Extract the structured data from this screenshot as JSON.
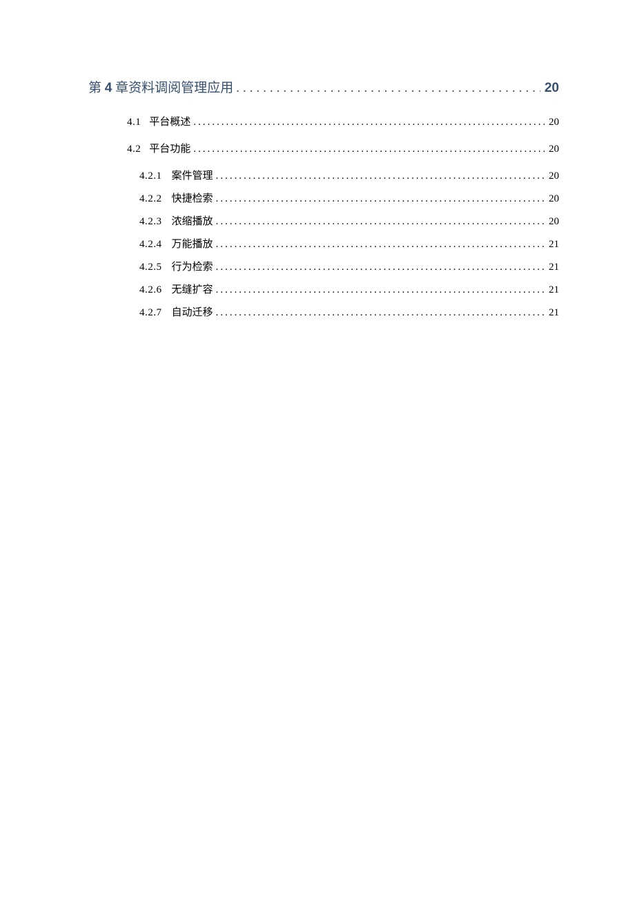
{
  "chapter": {
    "prefix": "第 ",
    "num": "4",
    "suffix": " 章",
    "title": "资料调阅管理应用",
    "page": "20"
  },
  "sections": [
    {
      "num": "4.1",
      "title": "平台概述",
      "page": "20"
    },
    {
      "num": "4.2",
      "title": "平台功能",
      "page": "20"
    }
  ],
  "subsections": [
    {
      "num": "4.2.1",
      "title": "案件管理",
      "page": "20"
    },
    {
      "num": "4.2.2",
      "title": "快捷检索",
      "page": "20"
    },
    {
      "num": "4.2.3",
      "title": "浓缩播放",
      "page": "20"
    },
    {
      "num": "4.2.4",
      "title": "万能播放",
      "page": "21"
    },
    {
      "num": "4.2.5",
      "title": "行为检索",
      "page": "21"
    },
    {
      "num": "4.2.6",
      "title": "无缝扩容",
      "page": "21"
    },
    {
      "num": "4.2.7",
      "title": "自动迁移",
      "page": "21"
    }
  ]
}
